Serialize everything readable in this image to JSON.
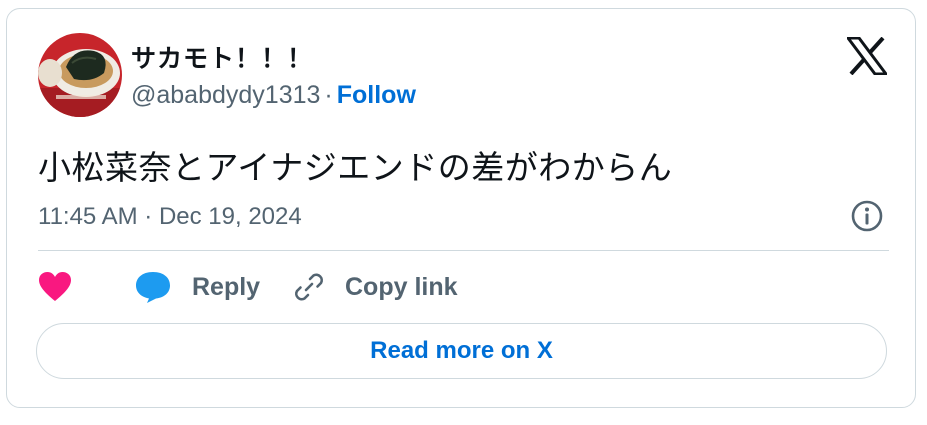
{
  "author": {
    "display_name": "サカモト！！！",
    "handle": "@ababdydy1313",
    "separator": "·",
    "follow_label": "Follow"
  },
  "tweet": {
    "text": "小松菜奈とアイナジエンドの差がわからん",
    "timestamp": "11:45 AM · Dec 19, 2024"
  },
  "actions": {
    "like_icon": "heart-icon",
    "reply_label": "Reply",
    "reply_icon": "speech-bubble-icon",
    "copy_label": "Copy link",
    "copy_icon": "link-icon"
  },
  "read_more_label": "Read more on X",
  "colors": {
    "like": "#f91880",
    "reply": "#1d9bf0",
    "link": "#006fd6",
    "muted": "#536471",
    "text": "#0f1419",
    "border": "#cfd9de"
  }
}
